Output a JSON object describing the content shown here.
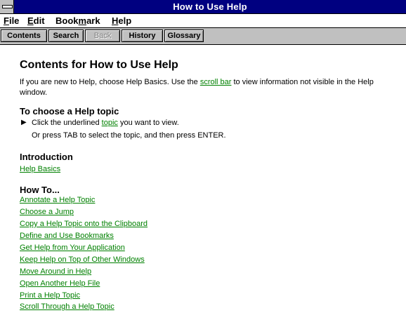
{
  "window": {
    "title": "How to Use Help"
  },
  "menu": [
    {
      "label": "File",
      "ul": "F"
    },
    {
      "label": "Edit",
      "ul": "E"
    },
    {
      "label": "Bookmark",
      "ul": "m"
    },
    {
      "label": "Help",
      "ul": "H"
    }
  ],
  "buttons": {
    "contents": "Contents",
    "search": "Search",
    "back": "Back",
    "history": "History",
    "glossary": "Glossary"
  },
  "content": {
    "title": "Contents for How to Use Help",
    "intro_before": "If you are new to Help, choose Help Basics. Use the ",
    "intro_link": "scroll bar",
    "intro_after": " to view information not visible in the Help window.",
    "choose_heading": "To choose a Help topic",
    "bullet": "▶",
    "step1_before": "Click the underlined ",
    "step1_link": "topic",
    "step1_after": " you want to view.",
    "step2": "Or press TAB to select the topic, and then press ENTER.",
    "introduction_heading": "Introduction",
    "help_basics": "Help Basics",
    "howto_heading": "How To...",
    "howto_links": [
      "Annotate a Help Topic",
      "Choose a Jump",
      "Copy a Help Topic onto the Clipboard",
      "Define and Use Bookmarks",
      "Get Help from Your Application",
      "Keep Help on Top of Other Windows",
      "Move Around in Help",
      "Open Another Help File",
      "Print a Help Topic",
      "Scroll Through a Help Topic"
    ]
  }
}
